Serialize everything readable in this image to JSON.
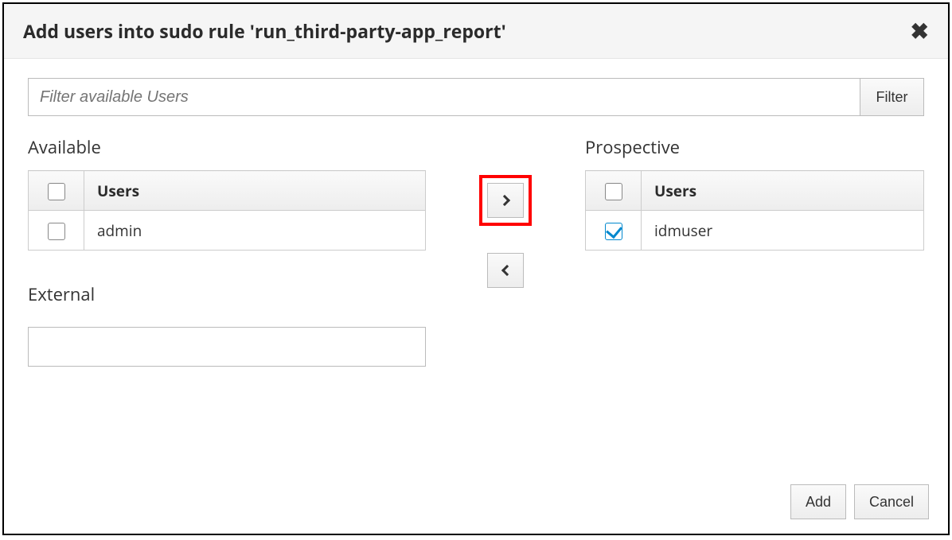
{
  "header": {
    "title": "Add users into sudo rule 'run_third-party-app_report'"
  },
  "filter": {
    "placeholder": "Filter available Users",
    "button": "Filter",
    "value": ""
  },
  "available": {
    "label": "Available",
    "column": "Users",
    "rows": [
      {
        "name": "admin",
        "checked": false
      }
    ]
  },
  "prospective": {
    "label": "Prospective",
    "column": "Users",
    "rows": [
      {
        "name": "idmuser",
        "checked": true
      }
    ]
  },
  "external": {
    "label": "External",
    "value": ""
  },
  "footer": {
    "add": "Add",
    "cancel": "Cancel"
  }
}
